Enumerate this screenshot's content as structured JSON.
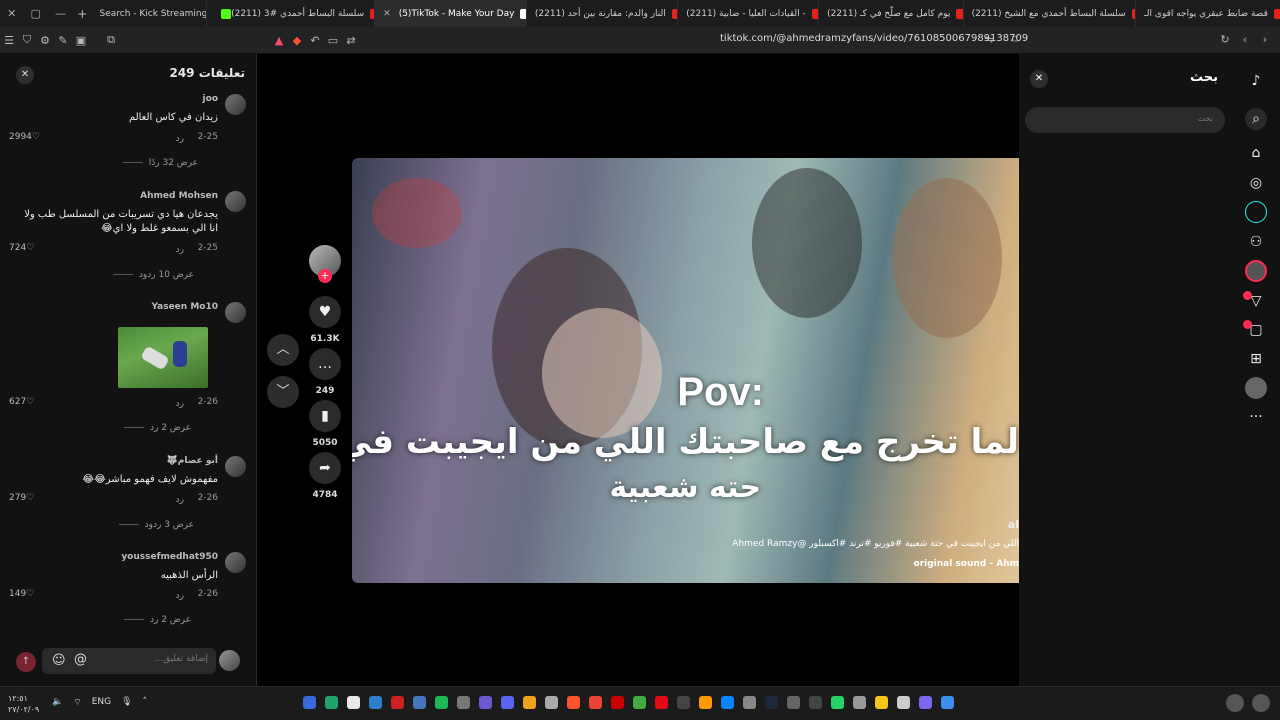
{
  "browser": {
    "tabs": [
      {
        "label": "Search - Kick Streaming",
        "color": "#53fc18"
      },
      {
        "label": "(2211) سلسلة البساط أحمدي #3",
        "color": "#e62117"
      },
      {
        "label": "(5)TikTok - Make Your Day",
        "color": "#111111"
      },
      {
        "label": "(2211) النار والدم: مقارنة بين أحد",
        "color": "#e62117"
      },
      {
        "label": "(2211) القيادات العليا - ضابية -",
        "color": "#e62117"
      },
      {
        "label": "(2211) يوم كامل مع صلّح في كـ",
        "color": "#e62117"
      },
      {
        "label": "(2211) سلسلة البساط أحمدي مع الشيخ",
        "color": "#e62117"
      },
      {
        "label": "قصة ضابط عبقري يواجه اقوى الـ",
        "color": "#e62117"
      }
    ],
    "url": "tiktok.com/@ahmedramzyfans/video/7610850067989138709"
  },
  "comments": {
    "title": "تعليقات 249",
    "items": [
      {
        "user": "joo",
        "text": "زيدان في كاس العالم",
        "date": "2-25",
        "reply": "رد",
        "likes": "2994",
        "more": "عرض 32 ردًا"
      },
      {
        "user": "Ahmed Mohsen",
        "text": "يجدعان هيا دي تسريبات من المسلسل طب ولا انا الي بسمعو غلط ولا اي😂",
        "date": "2-25",
        "reply": "رد",
        "likes": "724",
        "more": "عرض 10 ردود"
      },
      {
        "user": "Yaseen Mo10",
        "text": "",
        "date": "2-26",
        "reply": "رد",
        "likes": "627",
        "more": "عرض 2 رد"
      },
      {
        "user": "أبو عصام🐺",
        "text": "مفهموش لايف فهمو مباشر😂😂",
        "date": "2-26",
        "reply": "رد",
        "likes": "279",
        "more": "عرض 3 ردود"
      },
      {
        "user": "youssefmedhat950",
        "text": "الرأس الذهبيه",
        "date": "2-26",
        "reply": "رد",
        "likes": "149",
        "more": "عرض 2 رد"
      }
    ],
    "input_placeholder": "إضافة تعليق..."
  },
  "video": {
    "overlay_pov": "Pov:",
    "overlay_line1": "لما تخرج مع صاحبتك اللي من ايجيبت في",
    "overlay_line2": "حته شعبية",
    "username": "al",
    "caption": "اللي من ايجيبت في حتة شعبية #فوريو #ترند #اكسبلور @Ahmed Ramzy",
    "sound": "original sound - Ahm",
    "stats": {
      "likes": "61.3K",
      "comments": "249",
      "saves": "5050",
      "shares": "4784"
    }
  },
  "search": {
    "title": "بحث",
    "placeholder": "بحث"
  },
  "taskbar": {
    "time": "١٢:٥١",
    "date": "٢٧/٠٢/٠٩",
    "lang": "ENG"
  }
}
